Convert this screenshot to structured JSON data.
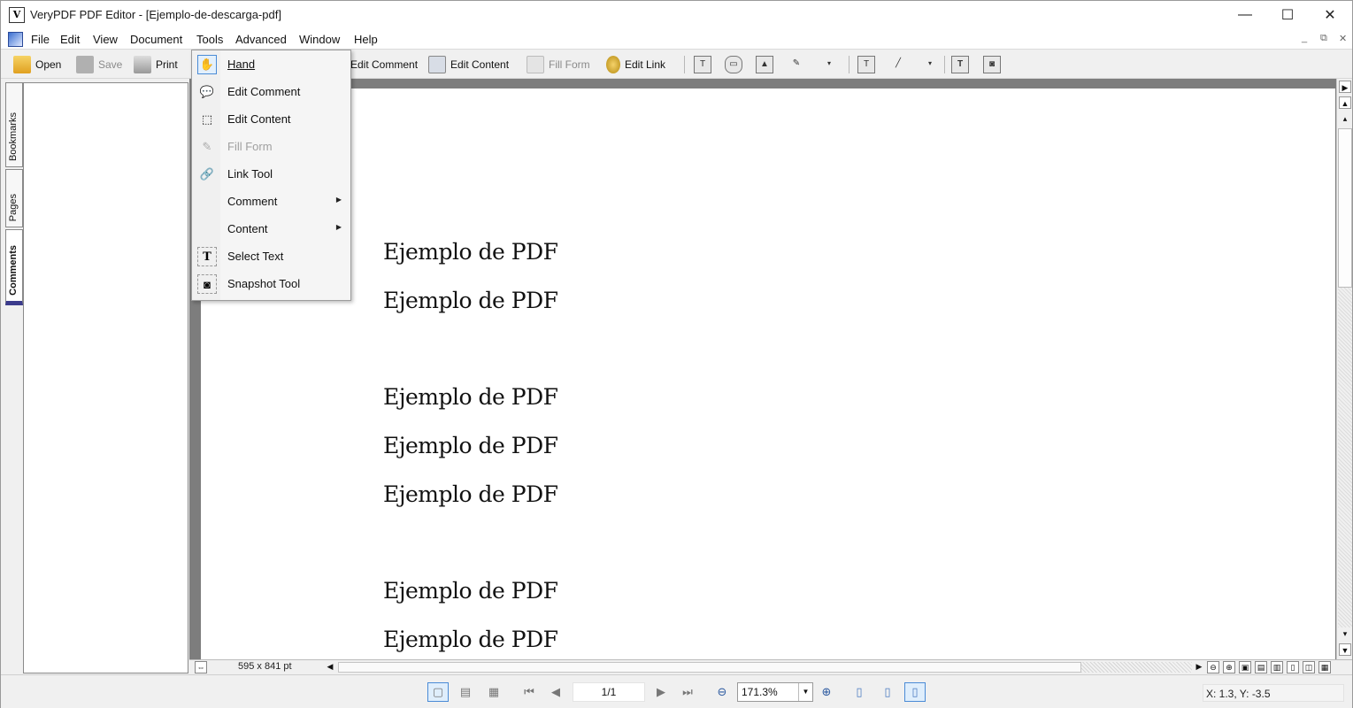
{
  "window": {
    "title": "VeryPDF PDF Editor - [Ejemplo-de-descarga-pdf]",
    "minimize_glyph": "—",
    "maximize_glyph": "☐",
    "close_glyph": "✕"
  },
  "menubar": {
    "items": [
      "File",
      "Edit",
      "View",
      "Document",
      "Tools",
      "Advanced",
      "Window",
      "Help"
    ],
    "mdi_controls": [
      "_",
      "⧉",
      "✕"
    ]
  },
  "toolbar": {
    "open": "Open",
    "save": "Save",
    "print": "Print",
    "edit_comment": "Edit Comment",
    "edit_content": "Edit Content",
    "fill_form": "Fill Form",
    "edit_link": "Edit Link"
  },
  "side_tabs": [
    "Bookmarks",
    "Pages",
    "Comments"
  ],
  "tools_menu": {
    "items": [
      {
        "label": "Hand",
        "icon": "hand-icon",
        "glyph": "✋",
        "state": "checked"
      },
      {
        "label": "Edit Comment",
        "icon": "comment-icon",
        "glyph": "💬",
        "state": "normal"
      },
      {
        "label": "Edit Content",
        "icon": "edit-content-icon",
        "glyph": "⬚",
        "state": "normal"
      },
      {
        "label": "Fill Form",
        "icon": "fill-form-icon",
        "glyph": "✎",
        "state": "disabled"
      },
      {
        "label": "Link Tool",
        "icon": "link-icon",
        "glyph": "🔗",
        "state": "normal"
      },
      {
        "label": "Comment",
        "icon": "",
        "glyph": "",
        "state": "submenu"
      },
      {
        "label": "Content",
        "icon": "",
        "glyph": "",
        "state": "submenu"
      },
      {
        "label": "Select Text",
        "icon": "select-text-icon",
        "glyph": "T",
        "state": "normal"
      },
      {
        "label": "Snapshot Tool",
        "icon": "snapshot-icon",
        "glyph": "◙",
        "state": "normal"
      }
    ]
  },
  "document": {
    "lines": [
      "Ejemplo de PDF",
      "Ejemplo de PDF",
      "Ejemplo de PDF",
      "Ejemplo de PDF",
      "Ejemplo de PDF",
      "Ejemplo de PDF",
      "Ejemplo de PDF"
    ]
  },
  "statusbar": {
    "page_size": "595 x 841 pt",
    "page_indicator": "1/1",
    "zoom": "171.3%",
    "coordinates": "X: 1.3, Y: -3.5"
  }
}
